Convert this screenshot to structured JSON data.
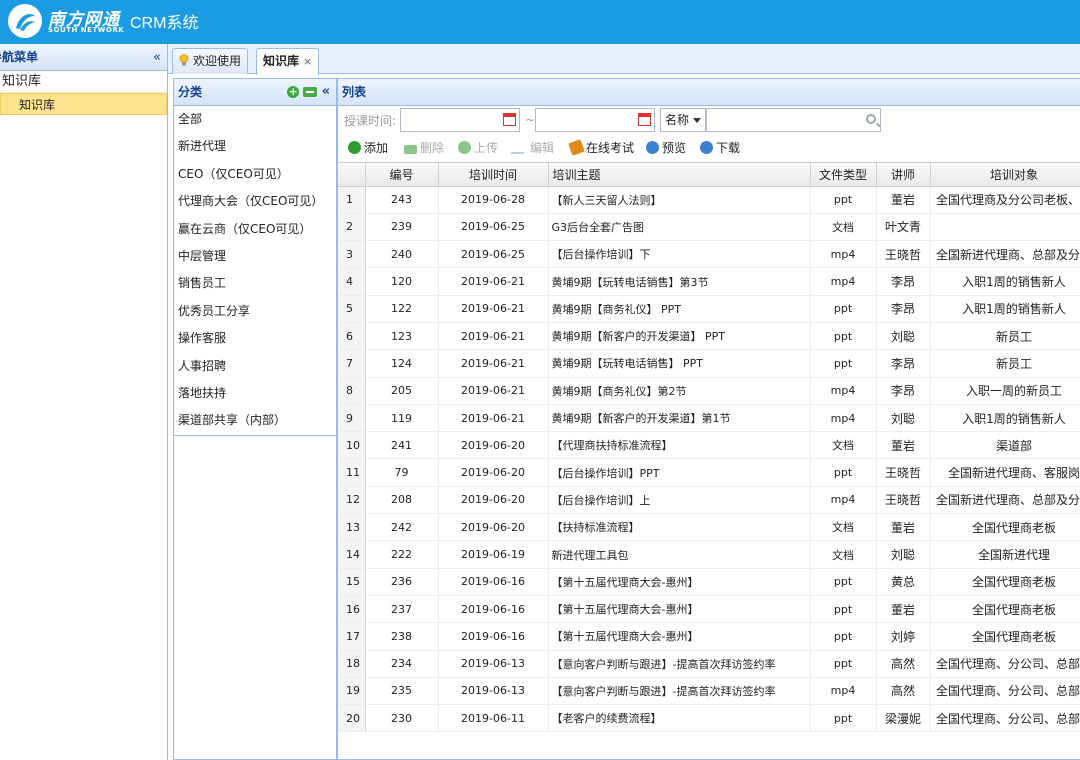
{
  "header": {
    "brand": "南方网通",
    "brand_sub": "SOUTH NETWORK",
    "app_title": "CRM系统",
    "color": "#1a9be3"
  },
  "nav": {
    "title": "导航菜单",
    "group": "知识库",
    "item": "知识库"
  },
  "tabs": [
    {
      "label": "欢迎使用",
      "icon": "bulb-icon"
    },
    {
      "label": "知识库",
      "close": "×"
    }
  ],
  "category": {
    "title": "分类",
    "items": [
      "全部",
      "新进代理",
      "CEO（仅CEO可见）",
      "代理商大会（仅CEO可见）",
      "赢在云商（仅CEO可见）",
      "中层管理",
      "销售员工",
      "优秀员工分享",
      "操作客服",
      "人事招聘",
      "落地扶持",
      "渠道部共享（内部）"
    ]
  },
  "list": {
    "title": "列表",
    "filter": {
      "date_label": "授课时间:",
      "tilde": "~",
      "select_value": "名称"
    },
    "toolbar": {
      "add": "添加",
      "delete": "删除",
      "upload": "上传",
      "edit": "编辑",
      "exam": "在线考试",
      "preview": "预览",
      "download": "下载"
    },
    "columns": [
      "编号",
      "培训时间",
      "培训主题",
      "文件类型",
      "讲师",
      "培训对象"
    ],
    "rows": [
      [
        "1",
        "243",
        "2019-06-28",
        "【新人三天留人法则】",
        "ppt",
        "董岩",
        "全国代理商及分公司老板、管"
      ],
      [
        "2",
        "239",
        "2019-06-25",
        "G3后台全套广告图",
        "文档",
        "叶文青",
        ""
      ],
      [
        "3",
        "240",
        "2019-06-25",
        "【后台操作培训】下",
        "mp4",
        "王晓哲",
        "全国新进代理商、总部及分公"
      ],
      [
        "4",
        "120",
        "2019-06-21",
        "黄埔9期【玩转电话销售】第3节",
        "mp4",
        "李昂",
        "入职1周的销售新人"
      ],
      [
        "5",
        "122",
        "2019-06-21",
        "黄埔9期【商务礼仪】 PPT",
        "ppt",
        "李昂",
        "入职1周的销售新人"
      ],
      [
        "6",
        "123",
        "2019-06-21",
        "黄埔9期【新客户的开发渠道】 PPT",
        "ppt",
        "刘聪",
        "新员工"
      ],
      [
        "7",
        "124",
        "2019-06-21",
        "黄埔9期【玩转电话销售】 PPT",
        "ppt",
        "李昂",
        "新员工"
      ],
      [
        "8",
        "205",
        "2019-06-21",
        "黄埔9期【商务礼仪】第2节",
        "mp4",
        "李昂",
        "入职一周的新员工"
      ],
      [
        "9",
        "119",
        "2019-06-21",
        "黄埔9期【新客户的开发渠道】第1节",
        "mp4",
        "刘聪",
        "入职1周的销售新人"
      ],
      [
        "10",
        "241",
        "2019-06-20",
        "【代理商扶持标准流程】",
        "文档",
        "董岩",
        "渠道部"
      ],
      [
        "11",
        "79",
        "2019-06-20",
        "【后台操作培训】PPT",
        "ppt",
        "王晓哲",
        "全国新进代理商、客服岗"
      ],
      [
        "12",
        "208",
        "2019-06-20",
        "【后台操作培训】上",
        "mp4",
        "王晓哲",
        "全国新进代理商、总部及分公"
      ],
      [
        "13",
        "242",
        "2019-06-20",
        "【扶持标准流程】",
        "文档",
        "董岩",
        "全国代理商老板"
      ],
      [
        "14",
        "222",
        "2019-06-19",
        "新进代理工具包",
        "文档",
        "刘聪",
        "全国新进代理"
      ],
      [
        "15",
        "236",
        "2019-06-16",
        "【第十五届代理商大会-惠州】",
        "ppt",
        "黄总",
        "全国代理商老板"
      ],
      [
        "16",
        "237",
        "2019-06-16",
        "【第十五届代理商大会-惠州】",
        "ppt",
        "董岩",
        "全国代理商老板"
      ],
      [
        "17",
        "238",
        "2019-06-16",
        "【第十五届代理商大会-惠州】",
        "ppt",
        "刘婷",
        "全国代理商老板"
      ],
      [
        "18",
        "234",
        "2019-06-13",
        "【意向客户判断与跟进】-提高首次拜访签约率",
        "ppt",
        "高然",
        "全国代理商、分公司、总部销"
      ],
      [
        "19",
        "235",
        "2019-06-13",
        "【意向客户判断与跟进】-提高首次拜访签约率",
        "mp4",
        "高然",
        "全国代理商、分公司、总部销"
      ],
      [
        "20",
        "230",
        "2019-06-11",
        "【老客户的续费流程】",
        "ppt",
        "梁漫妮",
        "全国代理商、分公司、总部销"
      ]
    ]
  }
}
